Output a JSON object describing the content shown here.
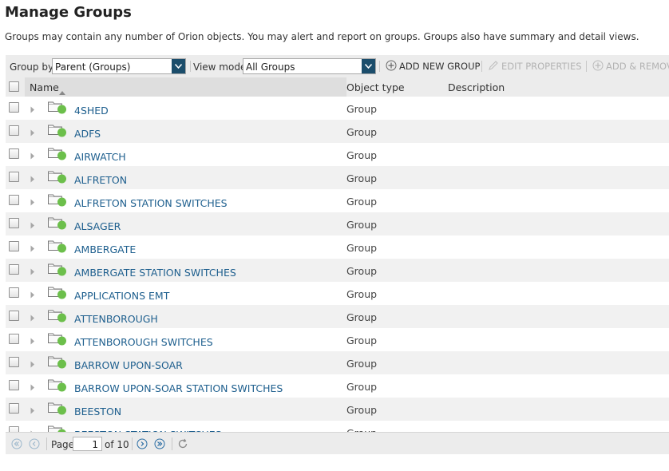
{
  "page": {
    "title": "Manage Groups",
    "description": "Groups may contain any number of Orion objects. You may alert and report on groups. Groups also have summary and detail views."
  },
  "toolbar": {
    "group_by_label": "Group by:",
    "group_by_value": "Parent (Groups)",
    "view_mode_label": "View mode:",
    "view_mode_value": "All Groups",
    "add_new_group": "ADD NEW GROUP",
    "edit_properties": "EDIT PROPERTIES",
    "add_remove": "ADD & REMOVE"
  },
  "grid": {
    "columns": {
      "name": "Name",
      "object_type": "Object type",
      "description": "Description"
    },
    "rows": [
      {
        "name": "4SHED",
        "type": "Group",
        "status_color": "#6cbf4b"
      },
      {
        "name": "ADFS",
        "type": "Group",
        "status_color": "#6cbf4b"
      },
      {
        "name": "AIRWATCH",
        "type": "Group",
        "status_color": "#6cbf4b"
      },
      {
        "name": "ALFRETON",
        "type": "Group",
        "status_color": "#6cbf4b"
      },
      {
        "name": "ALFRETON STATION SWITCHES",
        "type": "Group",
        "status_color": "#6cbf4b"
      },
      {
        "name": "ALSAGER",
        "type": "Group",
        "status_color": "#6cbf4b"
      },
      {
        "name": "AMBERGATE",
        "type": "Group",
        "status_color": "#6cbf4b"
      },
      {
        "name": "AMBERGATE STATION SWITCHES",
        "type": "Group",
        "status_color": "#6cbf4b"
      },
      {
        "name": "APPLICATIONS EMT",
        "type": "Group",
        "status_color": "#6cbf4b"
      },
      {
        "name": "ATTENBOROUGH",
        "type": "Group",
        "status_color": "#6cbf4b"
      },
      {
        "name": "ATTENBOROUGH SWITCHES",
        "type": "Group",
        "status_color": "#6cbf4b"
      },
      {
        "name": "BARROW UPON-SOAR",
        "type": "Group",
        "status_color": "#6cbf4b"
      },
      {
        "name": "BARROW UPON-SOAR STATION SWITCHES",
        "type": "Group",
        "status_color": "#6cbf4b"
      },
      {
        "name": "BEESTON",
        "type": "Group",
        "status_color": "#6cbf4b"
      },
      {
        "name": "BEESTON STATION SWITCHES",
        "type": "Group",
        "status_color": "#6cbf4b"
      }
    ]
  },
  "pager": {
    "page_label": "Page",
    "current_page": "1",
    "of_label": "of 10"
  },
  "colors": {
    "link": "#1e5f8e",
    "status_up": "#6cbf4b",
    "dropdown_arrow": "#1b4d6b"
  },
  "icons": {
    "first_page": "double-chevron-left-icon",
    "prev_page": "chevron-left-icon",
    "next_page": "chevron-right-icon",
    "last_page": "double-chevron-right-icon",
    "refresh": "refresh-icon",
    "add": "plus-circle-icon",
    "edit": "pencil-icon",
    "folder": "folder-icon",
    "status": "status-up-icon"
  }
}
